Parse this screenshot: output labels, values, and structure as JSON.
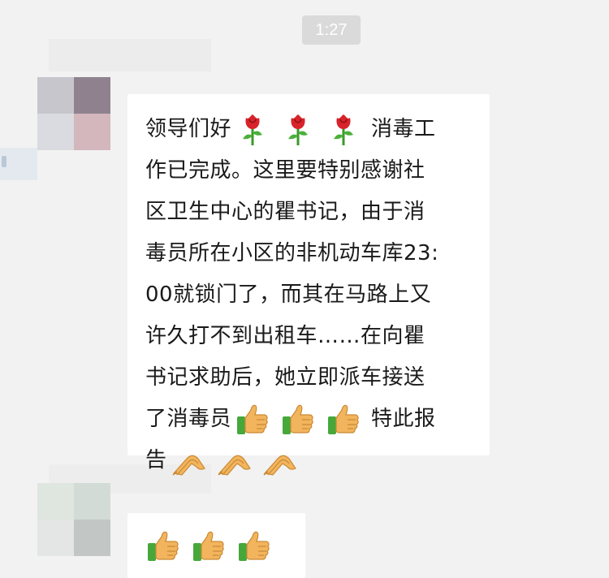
{
  "chat": {
    "timestamp": "1:27",
    "messages": [
      {
        "sender": "contact",
        "lines": [
          {
            "parts": [
              {
                "t": "text",
                "v": "领导们好"
              },
              {
                "t": "emoji",
                "v": "rose-icon"
              },
              {
                "t": "emoji",
                "v": "rose-icon"
              },
              {
                "t": "emoji",
                "v": "rose-icon"
              },
              {
                "t": "text",
                "v": "消毒工"
              }
            ]
          },
          {
            "parts": [
              {
                "t": "text",
                "v": "作已完成。这里要特别感谢社"
              }
            ]
          },
          {
            "parts": [
              {
                "t": "text",
                "v": "区卫生中心的瞿书记，由于消"
              }
            ]
          },
          {
            "parts": [
              {
                "t": "text",
                "v": "毒员所在小区的非机动车库23:"
              }
            ]
          },
          {
            "parts": [
              {
                "t": "text",
                "v": "00就锁门了，而其在马路上又"
              }
            ]
          },
          {
            "parts": [
              {
                "t": "text",
                "v": "许久打不到出租车……在向瞿"
              }
            ]
          },
          {
            "parts": [
              {
                "t": "text",
                "v": "书记求助后，她立即派车接送"
              }
            ]
          },
          {
            "parts": [
              {
                "t": "text",
                "v": "了消毒员"
              },
              {
                "t": "emoji",
                "v": "thumbs-up-icon"
              },
              {
                "t": "emoji",
                "v": "thumbs-up-icon"
              },
              {
                "t": "emoji",
                "v": "thumbs-up-icon"
              },
              {
                "t": "text",
                "v": "特此报"
              }
            ]
          },
          {
            "parts": [
              {
                "t": "text",
                "v": "告"
              },
              {
                "t": "emoji",
                "v": "pray-hands-icon"
              },
              {
                "t": "emoji",
                "v": "pray-hands-icon"
              },
              {
                "t": "emoji",
                "v": "pray-hands-icon"
              }
            ]
          }
        ]
      },
      {
        "sender": "contact",
        "lines": [
          {
            "parts": [
              {
                "t": "emoji",
                "v": "thumbs-up-icon"
              },
              {
                "t": "emoji",
                "v": "thumbs-up-icon"
              },
              {
                "t": "emoji",
                "v": "thumbs-up-icon"
              }
            ]
          }
        ]
      }
    ]
  },
  "colors": {
    "background": "#f2f2f2",
    "bubble": "#ffffff",
    "timestamp_bg": "#dadada",
    "text": "#1a1a1a"
  }
}
